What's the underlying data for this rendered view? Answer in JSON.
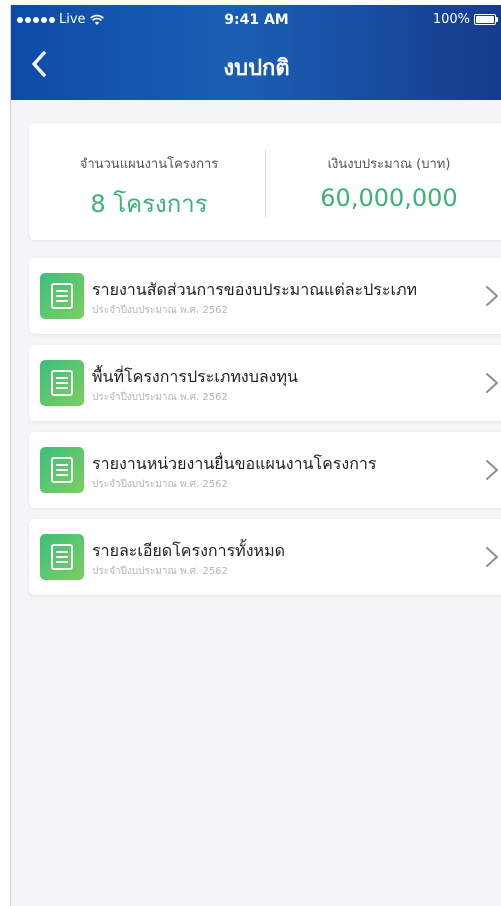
{
  "status_bar": {
    "carrier": "Live",
    "time": "9:41 AM",
    "battery_text": "100%",
    "icons": [
      "signal-dots-icon",
      "wifi-icon",
      "battery-icon"
    ]
  },
  "header": {
    "title": "งบปกติ",
    "back_icon": "chevron-left-icon",
    "gradient_colors": [
      "#0d4aa8",
      "#163b8c"
    ]
  },
  "summary": {
    "projects_label": "จำนวนแผนงานโครงการ",
    "projects_value": "8 โครงการ",
    "budget_label": "เงินงบประมาณ (บาท)",
    "budget_value": "60,000,000",
    "value_color": "#3bb277"
  },
  "reports": [
    {
      "title": "รายงานสัดส่วนการของบประมาณแต่ละประเภท",
      "subtitle": "ประจำปีงบประมาณ พ.ศ. 2562",
      "icon": "document-icon"
    },
    {
      "title": "พื้นที่โครงการประเภทงบลงทุน",
      "subtitle": "ประจำปีงบประมาณ พ.ศ. 2562",
      "icon": "document-icon"
    },
    {
      "title": "รายงานหน่วยงานยื่นขอแผนงานโครงการ",
      "subtitle": "ประจำปีงบประมาณ พ.ศ. 2562",
      "icon": "document-icon"
    },
    {
      "title": "รายละเอียดโครงการทั้งหมด",
      "subtitle": "ประจำปีงบประมาณ พ.ศ. 2562",
      "icon": "document-icon"
    }
  ]
}
